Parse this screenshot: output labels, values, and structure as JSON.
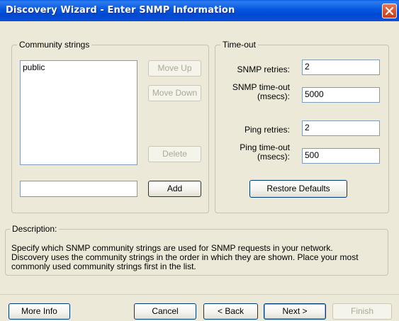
{
  "window": {
    "title": "Discovery Wizard - Enter SNMP Information"
  },
  "community": {
    "group_label": "Community strings",
    "items": [
      "public"
    ],
    "move_up_label": "Move Up",
    "move_down_label": "Move Down",
    "delete_label": "Delete",
    "add_label": "Add",
    "new_value": ""
  },
  "timeout": {
    "group_label": "Time-out",
    "snmp_retries_label": "SNMP retries:",
    "snmp_retries_value": "2",
    "snmp_timeout_label_line1": "SNMP time-out",
    "snmp_timeout_label_line2": "(msecs):",
    "snmp_timeout_value": "5000",
    "ping_retries_label": "Ping retries:",
    "ping_retries_value": "2",
    "ping_timeout_label_line1": "Ping time-out",
    "ping_timeout_label_line2": "(msecs):",
    "ping_timeout_value": "500",
    "restore_defaults_label": "Restore Defaults"
  },
  "description": {
    "group_label": "Description:",
    "line1": "Specify which SNMP community strings are used for SNMP requests in your network.",
    "line2": "Discovery uses the community strings in the order in which they are shown. Place your most",
    "line3": "commonly used community strings first in the list."
  },
  "footer": {
    "more_info_label": "More Info",
    "cancel_label": "Cancel",
    "back_label": "< Back",
    "next_label": "Next >",
    "finish_label": "Finish"
  },
  "icons": {
    "close": "close-icon"
  },
  "colors": {
    "title_bar": "#0a5fe6",
    "dialog_bg": "#ece9d8",
    "close_button": "#d9542e",
    "input_border": "#7f9db9",
    "button_border": "#003c74",
    "disabled_text": "#aca899"
  }
}
